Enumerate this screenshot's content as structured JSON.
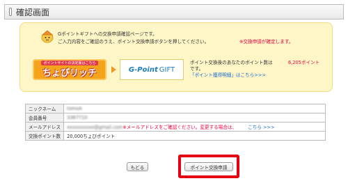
{
  "header": {
    "title": "確認画面"
  },
  "notice": {
    "line1": "Gポイントギフトへの交換申請確認ページです。",
    "line2": "ご入力内容をご確認のうえ、ポイント交換申請ボタンを押してください。",
    "warning": "※交換申請が確定します。",
    "mascot_icon": "mascot-icon"
  },
  "logos": {
    "choburi_small": "ポイントサイトの決定版はこちら",
    "choburi_big": "ちょびリッチ",
    "gpoint_g": "G-Point",
    "gpoint_gift": "GIFT"
  },
  "points": {
    "line1": "ポイント交換後のあなたのポイント数は",
    "value": "6,205ポイント",
    "line2": "です。",
    "link": "「ポイント獲得明細」はこちら>>>"
  },
  "details": {
    "rows": [
      {
        "label": "ニックネーム",
        "value": "tomoA"
      },
      {
        "label": "会員番号",
        "value": "3367710"
      },
      {
        "label": "メールアドレス",
        "value": "xxxxxxxxxx@gmail.com",
        "note": "※メールアドレスをご確認ください。変更する場合は、",
        "link": "こちら >>>"
      },
      {
        "label": "交換ポイント数",
        "value": "20,000ちょびポイント"
      }
    ]
  },
  "buttons": {
    "back": "もどる",
    "exchange": "ポイント交換申請"
  },
  "colors": {
    "accent_red": "#e6003c",
    "link_blue": "#1a6fd1",
    "notice_bg": "#fff6c8",
    "highlight": "#e60012"
  }
}
